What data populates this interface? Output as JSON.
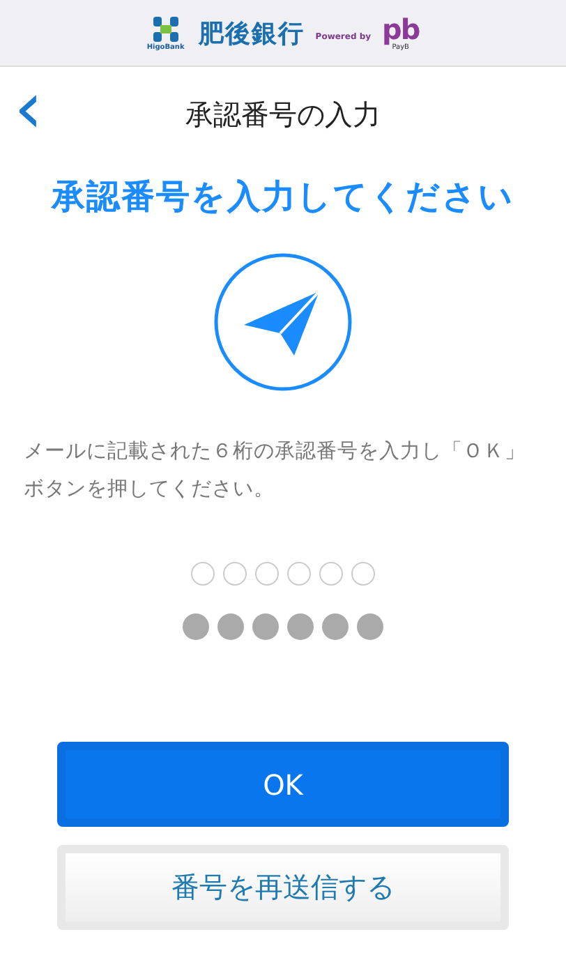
{
  "header": {
    "bank_name": "肥後銀行",
    "bank_name_en": "HigoBank",
    "powered_by": "Powered by",
    "partner_logo": "pb",
    "partner_name": "PayB"
  },
  "nav": {
    "back": "‹",
    "title": "承認番号の入力"
  },
  "heading": "承認番号を入力してください",
  "description": "メールに記載された６桁の承認番号を入力し「ＯＫ」ボタンを押してください。",
  "code_slots": [
    {
      "filled": false
    },
    {
      "filled": false
    },
    {
      "filled": false
    },
    {
      "filled": false
    },
    {
      "filled": false
    },
    {
      "filled": false
    }
  ],
  "code_dots": [
    {
      "filled": true
    },
    {
      "filled": true
    },
    {
      "filled": true
    },
    {
      "filled": true
    },
    {
      "filled": true
    },
    {
      "filled": true
    }
  ],
  "buttons": [
    {
      "kind": "primary",
      "label": "OK"
    },
    {
      "kind": "secondary",
      "label": "番号を再送信する"
    }
  ]
}
